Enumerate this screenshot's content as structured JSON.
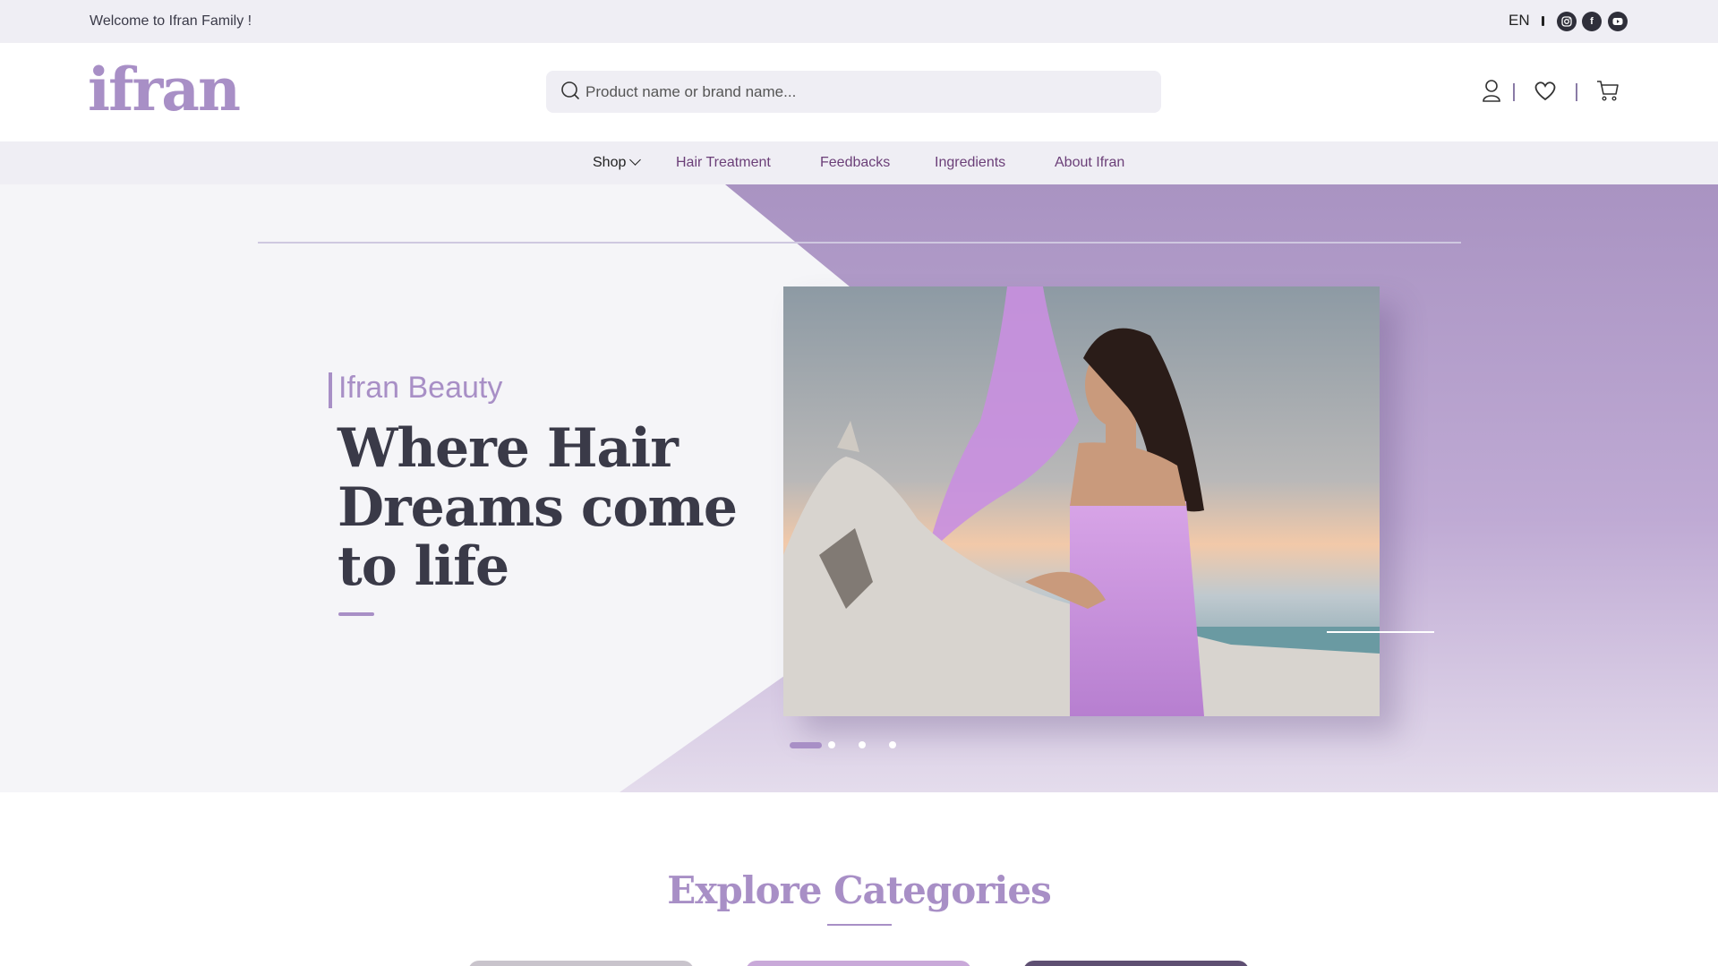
{
  "topbar": {
    "welcome": "Welcome to Ifran Family !",
    "language": "EN",
    "social": [
      "instagram-icon",
      "facebook-icon",
      "youtube-icon"
    ]
  },
  "header": {
    "logo": "ifran",
    "search": {
      "placeholder": "Product name or brand name..."
    },
    "icons": [
      "user-icon",
      "heart-icon",
      "cart-icon"
    ]
  },
  "nav": {
    "items": [
      {
        "label": "Shop"
      },
      {
        "label": "Hair Treatment"
      },
      {
        "label": "Feedbacks"
      },
      {
        "label": "Ingredients"
      },
      {
        "label": "About Ifran"
      }
    ]
  },
  "hero": {
    "eyebrow": "Ifran Beauty",
    "headline": "Where Hair Dreams come to life",
    "slides": 4,
    "active_slide": 1
  },
  "categories": {
    "title": "Explore Categories"
  },
  "colors": {
    "accent": "#a88fc6",
    "nav_text": "#6b3f78",
    "dark_text": "#3a3a48",
    "topbar_bg": "#efeef4"
  }
}
